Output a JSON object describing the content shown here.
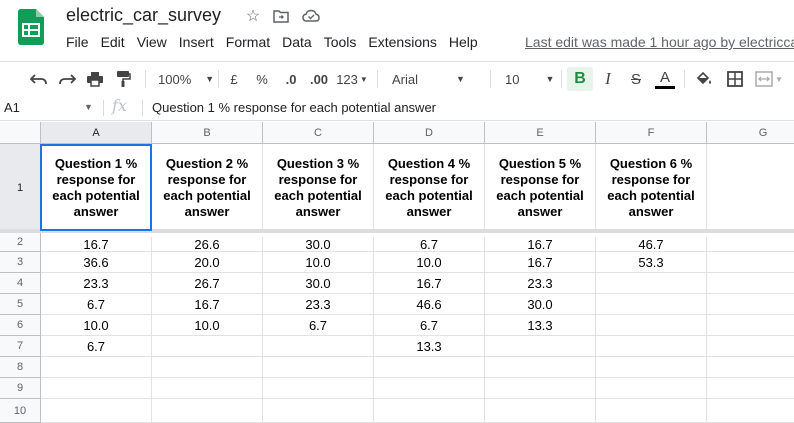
{
  "app": {
    "title": "electric_car_survey",
    "menu": [
      "File",
      "Edit",
      "View",
      "Insert",
      "Format",
      "Data",
      "Tools",
      "Extensions",
      "Help"
    ],
    "last_edit": "Last edit was made 1 hour ago by electricca"
  },
  "toolbar": {
    "zoom": "100%",
    "currency": "£",
    "percent": "%",
    "dec_decrease": ".0",
    "dec_increase": ".00",
    "more_formats": "123",
    "font": "Arial",
    "font_size": "10",
    "bold": "B",
    "italic": "I",
    "strike": "S",
    "text_color": "A"
  },
  "formula_bar": {
    "cell_ref": "A1",
    "fx": "fx",
    "content": "Question 1 % response for each potential answer"
  },
  "sheet": {
    "columns": [
      "A",
      "B",
      "C",
      "D",
      "E",
      "F",
      "G"
    ],
    "rows": [
      "1",
      "2",
      "3",
      "4",
      "5",
      "6",
      "7",
      "8",
      "9",
      "10"
    ],
    "headers": [
      "Question 1 % response for each potential answer",
      "Question 2 % response for each potential answer",
      "Question 3 % response for each potential answer",
      "Question 4 % response for each potential answer",
      "Question 5 % response for each potential answer",
      "Question 6 % response for each potential answer",
      ""
    ],
    "data": [
      [
        "16.7",
        "26.6",
        "30.0",
        "6.7",
        "16.7",
        "46.7",
        ""
      ],
      [
        "36.6",
        "20.0",
        "10.0",
        "10.0",
        "16.7",
        "53.3",
        ""
      ],
      [
        "23.3",
        "26.7",
        "30.0",
        "16.7",
        "23.3",
        "",
        ""
      ],
      [
        "6.7",
        "16.7",
        "23.3",
        "46.6",
        "30.0",
        "",
        ""
      ],
      [
        "10.0",
        "10.0",
        "6.7",
        "6.7",
        "13.3",
        "",
        ""
      ],
      [
        "6.7",
        "",
        "",
        "13.3",
        "",
        "",
        ""
      ],
      [
        "",
        "",
        "",
        "",
        "",
        "",
        ""
      ],
      [
        "",
        "",
        "",
        "",
        "",
        "",
        ""
      ],
      [
        "",
        "",
        "",
        "",
        "",
        "",
        ""
      ]
    ]
  },
  "colors": {
    "accent": "#1a73e8",
    "sheets_green": "#0f9d58",
    "bold_active_bg": "#e6f4ea"
  }
}
